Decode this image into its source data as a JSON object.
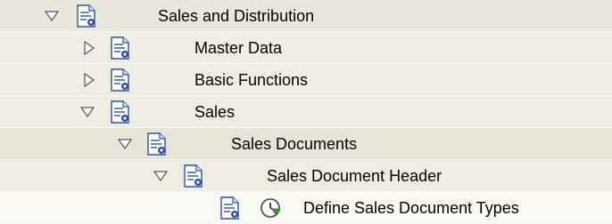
{
  "tree": {
    "nodes": [
      {
        "label": "Sales and Distribution",
        "expanded": true,
        "icon": "document-icon"
      },
      {
        "label": "Master Data",
        "expanded": false,
        "icon": "document-icon"
      },
      {
        "label": "Basic Functions",
        "expanded": false,
        "icon": "document-icon"
      },
      {
        "label": "Sales",
        "expanded": true,
        "icon": "document-icon"
      },
      {
        "label": "Sales Documents",
        "expanded": true,
        "icon": "document-icon"
      },
      {
        "label": "Sales Document Header",
        "expanded": true,
        "icon": "document-icon"
      },
      {
        "label": "Define Sales Document Types",
        "leaf": true,
        "icon": "document-icon",
        "action_icon": "execute-clock-icon"
      }
    ]
  }
}
